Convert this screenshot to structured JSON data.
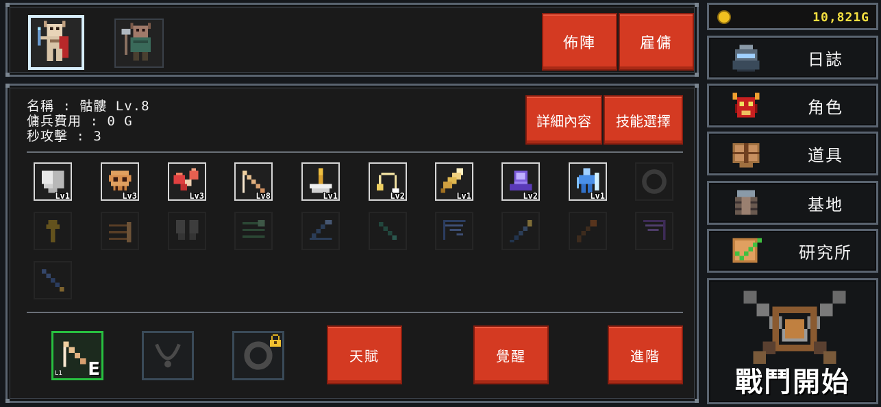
{
  "header": {
    "heroes": [
      {
        "name": "skeleton-hero",
        "selected": true
      },
      {
        "name": "goblin-axe-hero",
        "selected": false
      }
    ],
    "buttons": {
      "formation": "佈陣",
      "hire": "雇傭"
    }
  },
  "character": {
    "name_line": "名稱 : 骷髏 Lv.8",
    "cost_line": "傭兵費用 : 0 G",
    "attack_line": "秒攻擊 : 3",
    "buttons": {
      "details": "詳細內容",
      "skill_select": "技能選擇"
    }
  },
  "skills": {
    "unlocked": [
      {
        "icon": "shield-icon",
        "level": "Lv1"
      },
      {
        "icon": "skull-icon",
        "level": "Lv3"
      },
      {
        "icon": "meat-icon",
        "level": "Lv3"
      },
      {
        "icon": "bow-icon",
        "level": "Lv8"
      },
      {
        "icon": "trophy-icon",
        "level": "Lv1"
      },
      {
        "icon": "arc-arrow-icon",
        "level": "Lv2"
      },
      {
        "icon": "feather-icon",
        "level": "Lv1"
      },
      {
        "icon": "purple-orb-icon",
        "level": "Lv2"
      },
      {
        "icon": "blue-spirit-icon",
        "level": "Lv1"
      }
    ],
    "locked": [
      "ring-icon",
      "up-arrow-icon",
      "arrow-volley-icon",
      "broken-shield-icon",
      "green-arrows-icon",
      "blue-arrows-icon",
      "snake-bow-icon",
      "crossbow-icon",
      "blue-arrow-icon",
      "torch-icon",
      "purple-crossbow-icon",
      "blue-ice-arrow-icon"
    ]
  },
  "equipment": {
    "slot1": {
      "level": "L1",
      "badge": "E"
    }
  },
  "actions": {
    "talent": "天賦",
    "awaken": "覺醒",
    "advance": "進階"
  },
  "sidebar": {
    "gold": "10,821G",
    "menu": [
      {
        "label": "日誌",
        "icon": "helmet-icon"
      },
      {
        "label": "角色",
        "icon": "demon-mask-icon"
      },
      {
        "label": "道具",
        "icon": "shield-chest-icon"
      },
      {
        "label": "基地",
        "icon": "barrel-base-icon"
      },
      {
        "label": "研究所",
        "icon": "checkmark-icon"
      }
    ],
    "battle": "戰鬥開始"
  }
}
